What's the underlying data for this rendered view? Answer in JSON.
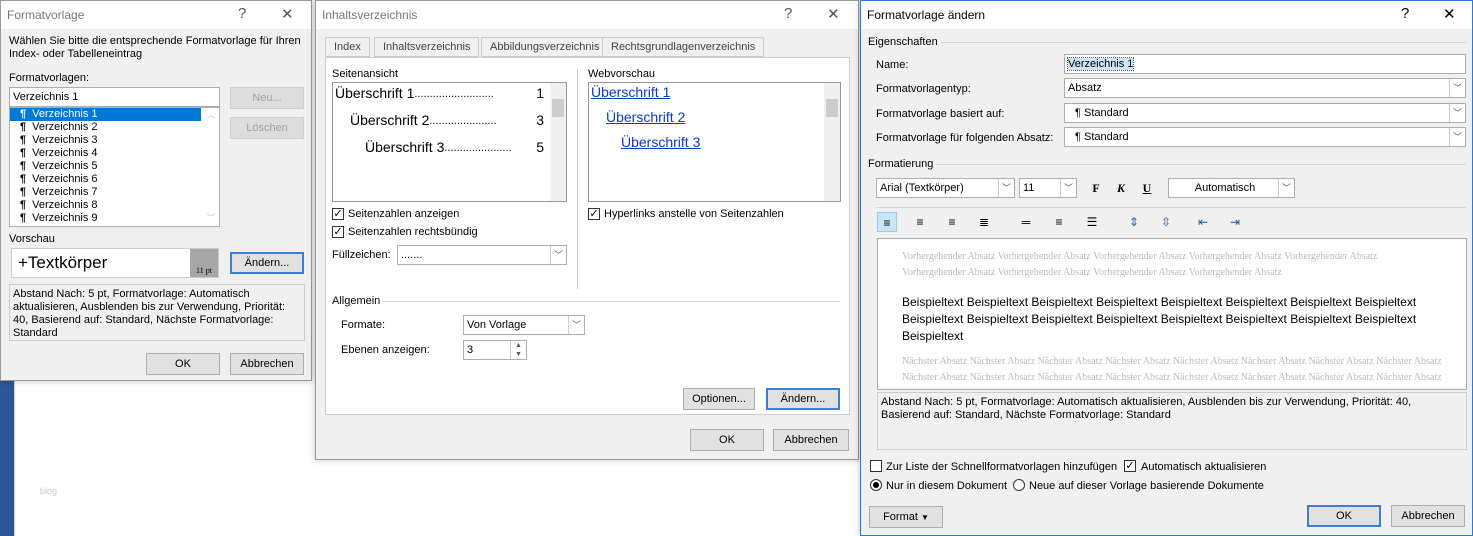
{
  "background": {
    "faint_text": "blog"
  },
  "dialog1": {
    "title": "Formatvorlage",
    "help": "?",
    "close": "✕",
    "instruction": "Wählen Sie bitte die entsprechende Formatvorlage für Ihren Index- oder Tabelleneintrag",
    "styles_label": "Formatvorlagen:",
    "style_input": "Verzeichnis 1",
    "styles": [
      "Verzeichnis 1",
      "Verzeichnis 2",
      "Verzeichnis 3",
      "Verzeichnis 4",
      "Verzeichnis 5",
      "Verzeichnis 6",
      "Verzeichnis 7",
      "Verzeichnis 8",
      "Verzeichnis 9"
    ],
    "para_mark": "¶",
    "new_button": "Neu...",
    "delete_button": "Löschen",
    "preview_label": "Vorschau",
    "preview_text": "+Textkörper",
    "preview_size": "11 pt",
    "modify_button": "Ändern...",
    "description": "Abstand Nach:  5 pt, Formatvorlage: Automatisch aktualisieren, Ausblenden bis zur Verwendung, Priorität: 40, Basierend auf: Standard, Nächste Formatvorlage: Standard",
    "ok": "OK",
    "cancel": "Abbrechen"
  },
  "dialog2": {
    "title": "Inhaltsverzeichnis",
    "help": "?",
    "close": "✕",
    "tabs": [
      "Index",
      "Inhaltsverzeichnis",
      "Abbildungsverzeichnis",
      "Rechtsgrundlagenverzeichnis"
    ],
    "print_preview_label": "Seitenansicht",
    "print_preview": [
      {
        "text": "Überschrift 1",
        "dots": "..........................",
        "page": "1"
      },
      {
        "text": "Überschrift 2",
        "dots": "......................",
        "page": "3"
      },
      {
        "text": "Überschrift 3",
        "dots": "......................",
        "page": "5"
      }
    ],
    "web_preview_label": "Webvorschau",
    "web_preview": [
      "Überschrift 1",
      "Überschrift 2",
      "Überschrift 3"
    ],
    "show_page_numbers": "Seitenzahlen anzeigen",
    "right_align": "Seitenzahlen rechtsbündig",
    "hyperlinks": "Hyperlinks anstelle von Seitenzahlen",
    "tab_leader_label": "Füllzeichen:",
    "tab_leader": ".......",
    "general_label": "Allgemein",
    "formats_label": "Formate:",
    "formats_value": "Von Vorlage",
    "levels_label": "Ebenen anzeigen:",
    "levels_value": "3",
    "options_button": "Optionen...",
    "modify_button": "Ändern...",
    "ok": "OK",
    "cancel": "Abbrechen"
  },
  "dialog3": {
    "title": "Formatvorlage ändern",
    "help": "?",
    "close": "✕",
    "properties_label": "Eigenschaften",
    "name_label": "Name:",
    "name_value": "Verzeichnis 1",
    "type_label": "Formatvorlagentyp:",
    "type_value": "Absatz",
    "based_label": "Formatvorlage basiert auf:",
    "based_value": "Standard",
    "next_label": "Formatvorlage für folgenden Absatz:",
    "next_value": "Standard",
    "para_mark": "¶",
    "formatting_label": "Formatierung",
    "font": "Arial (Textkörper)",
    "size": "11",
    "bold": "F",
    "italic": "K",
    "underline": "U",
    "color": "Automatisch",
    "prev_para": "Vorhergehender Absatz Vorhergehender Absatz Vorhergehender Absatz Vorhergehender Absatz Vorhergehender Absatz Vorhergehender Absatz Vorhergehender Absatz Vorhergehender Absatz Vorhergehender Absatz",
    "sample": "Beispieltext Beispieltext Beispieltext Beispieltext Beispieltext Beispieltext Beispieltext Beispieltext Beispieltext Beispieltext Beispieltext Beispieltext Beispieltext Beispieltext Beispieltext Beispieltext Beispieltext",
    "next_para": "Nächster Absatz Nächster Absatz Nächster Absatz Nächster Absatz Nächster Absatz Nächster Absatz Nächster Absatz Nächster Absatz Nächster Absatz Nächster Absatz Nächster Absatz Nächster Absatz Nächster Absatz Nächster Absatz Nächster Absatz Nächster Absatz Nächster Absatz Nächster Absatz Nächster Absatz Nächster Absatz",
    "description": "Abstand Nach:  5 pt, Formatvorlage: Automatisch aktualisieren, Ausblenden bis zur Verwendung, Priorität: 40, Basierend auf: Standard, Nächste Formatvorlage: Standard",
    "add_quick": "Zur Liste der Schnellformatvorlagen hinzufügen",
    "auto_update": "Automatisch aktualisieren",
    "only_doc": "Nur in diesem Dokument",
    "new_docs": "Neue auf dieser Vorlage basierende Dokumente",
    "format_button": "Format",
    "ok": "OK",
    "cancel": "Abbrechen"
  },
  "colors": {
    "accent": "#0078d7",
    "link": "#0b39c9"
  }
}
